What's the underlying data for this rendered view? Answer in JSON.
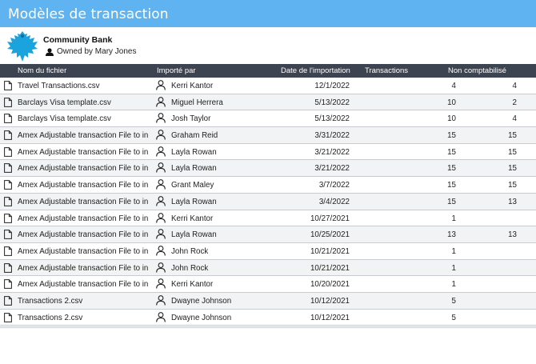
{
  "app": {
    "title": "Modèles de transaction"
  },
  "account": {
    "bank_name": "Community Bank",
    "owner": "Owned by Mary Jones",
    "logo_icon": "eagle-logo-icon"
  },
  "colors": {
    "titlebar": "#5fb3f0",
    "header_bar": "#3d4451"
  },
  "columns": {
    "file": "Nom du fichier",
    "user": "Importé par",
    "date": "Date de l'importation",
    "transactions": "Transactions",
    "uncategorized": "Non comptabilisé"
  },
  "rows": [
    {
      "file": "Travel Transactions.csv",
      "user": "Kerri Kantor",
      "date": "12/1/2022",
      "tx": "4",
      "nc": "4"
    },
    {
      "file": "Barclays Visa template.csv",
      "user": "Miguel Herrera",
      "date": "5/13/2022",
      "tx": "10",
      "nc": "2"
    },
    {
      "file": "Barclays Visa template.csv",
      "user": "Josh Taylor",
      "date": "5/13/2022",
      "tx": "10",
      "nc": "4"
    },
    {
      "file": "Amex Adjustable transaction File to in",
      "user": "Graham Reid",
      "date": "3/31/2022",
      "tx": "15",
      "nc": "15"
    },
    {
      "file": "Amex Adjustable transaction File to in",
      "user": "Layla Rowan",
      "date": "3/21/2022",
      "tx": "15",
      "nc": "15"
    },
    {
      "file": "Amex Adjustable transaction File to in",
      "user": "Layla Rowan",
      "date": "3/21/2022",
      "tx": "15",
      "nc": "15"
    },
    {
      "file": "Amex Adjustable transaction File to in",
      "user": "Grant Maley",
      "date": "3/7/2022",
      "tx": "15",
      "nc": "15"
    },
    {
      "file": "Amex Adjustable transaction File to in",
      "user": "Layla Rowan",
      "date": "3/4/2022",
      "tx": "15",
      "nc": "13"
    },
    {
      "file": "Amex Adjustable transaction File to in",
      "user": "Kerri Kantor",
      "date": "10/27/2021",
      "tx": "1",
      "nc": ""
    },
    {
      "file": "Amex Adjustable transaction File to in",
      "user": "Layla Rowan",
      "date": "10/25/2021",
      "tx": "13",
      "nc": "13"
    },
    {
      "file": "Amex Adjustable transaction File to in",
      "user": "John Rock",
      "date": "10/21/2021",
      "tx": "1",
      "nc": ""
    },
    {
      "file": "Amex Adjustable transaction File to in",
      "user": "John Rock",
      "date": "10/21/2021",
      "tx": "1",
      "nc": ""
    },
    {
      "file": "Amex Adjustable transaction File to in",
      "user": "Kerri Kantor",
      "date": "10/20/2021",
      "tx": "1",
      "nc": ""
    },
    {
      "file": "Transactions 2.csv",
      "user": "Dwayne Johnson",
      "date": "10/12/2021",
      "tx": "5",
      "nc": ""
    },
    {
      "file": "Transactions 2.csv",
      "user": "Dwayne Johnson",
      "date": "10/12/2021",
      "tx": "5",
      "nc": ""
    }
  ]
}
